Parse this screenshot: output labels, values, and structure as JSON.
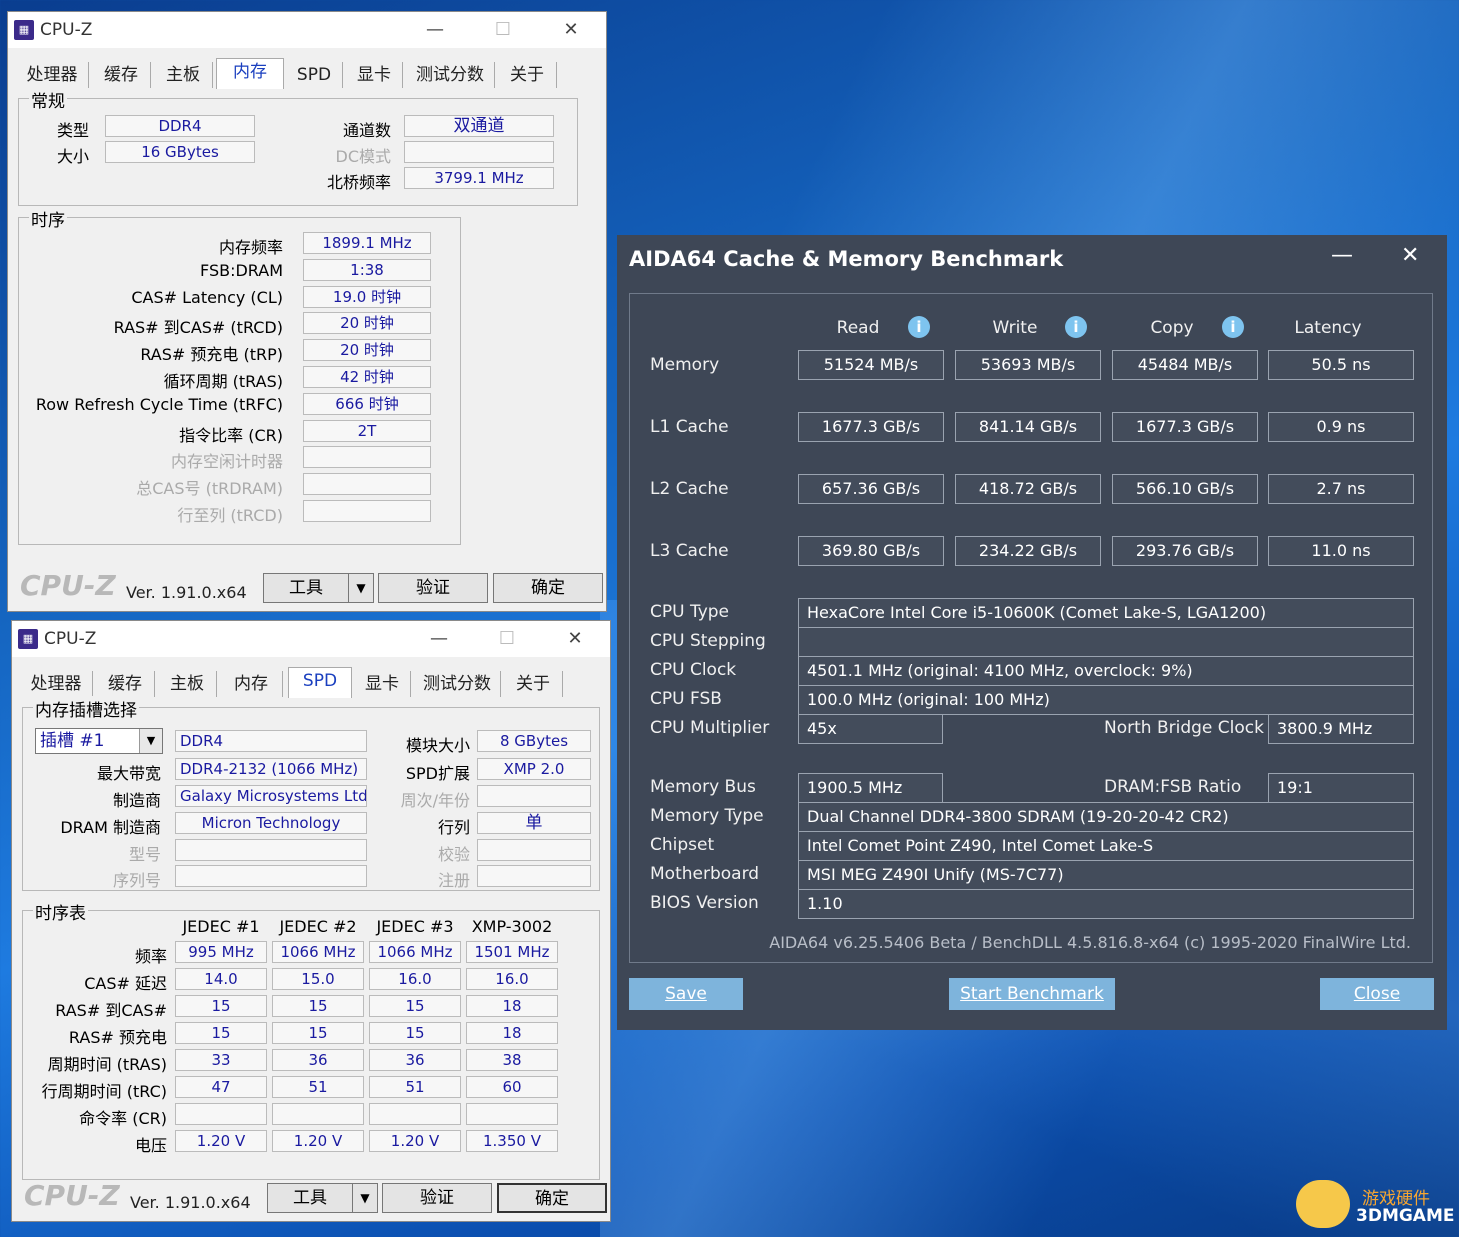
{
  "cpuz_top": {
    "title": "CPU-Z",
    "tabs": [
      "处理器",
      "缓存",
      "主板",
      "内存",
      "SPD",
      "显卡",
      "测试分数",
      "关于"
    ],
    "active_tab": "内存",
    "general": {
      "title": "常规",
      "type_label": "类型",
      "type_value": "DDR4",
      "size_label": "大小",
      "size_value": "16 GBytes",
      "channels_label": "通道数",
      "channels_value": "双通道",
      "dc_label": "DC模式",
      "dc_value": "",
      "nb_label": "北桥频率",
      "nb_value": "3799.1 MHz"
    },
    "timings": {
      "title": "时序",
      "rows": [
        {
          "label": "内存频率",
          "value": "1899.1 MHz",
          "dim": false
        },
        {
          "label": "FSB:DRAM",
          "value": "1:38",
          "dim": false
        },
        {
          "label": "CAS# Latency (CL)",
          "value": "19.0 时钟",
          "dim": false
        },
        {
          "label": "RAS# 到CAS# (tRCD)",
          "value": "20 时钟",
          "dim": false
        },
        {
          "label": "RAS# 预充电 (tRP)",
          "value": "20 时钟",
          "dim": false
        },
        {
          "label": "循环周期 (tRAS)",
          "value": "42 时钟",
          "dim": false
        },
        {
          "label": "Row Refresh Cycle Time (tRFC)",
          "value": "666 时钟",
          "dim": false
        },
        {
          "label": "指令比率 (CR)",
          "value": "2T",
          "dim": false
        },
        {
          "label": "内存空闲计时器",
          "value": "",
          "dim": true
        },
        {
          "label": "总CAS号 (tRDRAM)",
          "value": "",
          "dim": true
        },
        {
          "label": "行至列 (tRCD)",
          "value": "",
          "dim": true
        }
      ]
    },
    "logo": "CPU-Z",
    "version": "Ver. 1.91.0.x64",
    "tools_button": "工具",
    "validate_button": "验证",
    "ok_button": "确定"
  },
  "cpuz_bottom": {
    "title": "CPU-Z",
    "tabs": [
      "处理器",
      "缓存",
      "主板",
      "内存",
      "SPD",
      "显卡",
      "测试分数",
      "关于"
    ],
    "active_tab": "SPD",
    "slot": {
      "title": "内存插槽选择",
      "slot_value": "插槽 #1",
      "type_value": "DDR4",
      "module_size_label": "模块大小",
      "module_size_value": "8 GBytes",
      "max_bw_label": "最大带宽",
      "max_bw_value": "DDR4-2132 (1066 MHz)",
      "spd_ext_label": "SPD扩展",
      "spd_ext_value": "XMP 2.0",
      "mfr_label": "制造商",
      "mfr_value": "Galaxy Microsystems Ltd.",
      "week_label": "周次/年份",
      "week_value": "",
      "dram_mfr_label": "DRAM 制造商",
      "dram_mfr_value": "Micron Technology",
      "ranks_label": "行列",
      "ranks_value": "单",
      "model_label": "型号",
      "model_value": "",
      "check_label": "校验",
      "check_value": "",
      "serial_label": "序列号",
      "serial_value": "",
      "reg_label": "注册",
      "reg_value": ""
    },
    "timing_table": {
      "title": "时序表",
      "columns": [
        "JEDEC #1",
        "JEDEC #2",
        "JEDEC #3",
        "XMP-3002"
      ],
      "rows": [
        {
          "label": "频率",
          "values": [
            "995 MHz",
            "1066 MHz",
            "1066 MHz",
            "1501 MHz"
          ]
        },
        {
          "label": "CAS# 延迟",
          "values": [
            "14.0",
            "15.0",
            "16.0",
            "16.0"
          ]
        },
        {
          "label": "RAS# 到CAS#",
          "values": [
            "15",
            "15",
            "15",
            "18"
          ]
        },
        {
          "label": "RAS# 预充电",
          "values": [
            "15",
            "15",
            "15",
            "18"
          ]
        },
        {
          "label": "周期时间 (tRAS)",
          "values": [
            "33",
            "36",
            "36",
            "38"
          ]
        },
        {
          "label": "行周期时间 (tRC)",
          "values": [
            "47",
            "51",
            "51",
            "60"
          ]
        },
        {
          "label": "命令率 (CR)",
          "values": [
            "",
            "",
            "",
            ""
          ]
        },
        {
          "label": "电压",
          "values": [
            "1.20 V",
            "1.20 V",
            "1.20 V",
            "1.350 V"
          ]
        }
      ]
    },
    "logo": "CPU-Z",
    "version": "Ver. 1.91.0.x64",
    "tools_button": "工具",
    "validate_button": "验证",
    "ok_button": "确定"
  },
  "aida": {
    "title": "AIDA64 Cache & Memory Benchmark",
    "headers": [
      "Read",
      "Write",
      "Copy",
      "Latency"
    ],
    "bench_rows": [
      {
        "label": "Memory",
        "values": [
          "51524 MB/s",
          "53693 MB/s",
          "45484 MB/s",
          "50.5 ns"
        ]
      },
      {
        "label": "L1 Cache",
        "values": [
          "1677.3 GB/s",
          "841.14 GB/s",
          "1677.3 GB/s",
          "0.9 ns"
        ]
      },
      {
        "label": "L2 Cache",
        "values": [
          "657.36 GB/s",
          "418.72 GB/s",
          "566.10 GB/s",
          "2.7 ns"
        ]
      },
      {
        "label": "L3 Cache",
        "values": [
          "369.80 GB/s",
          "234.22 GB/s",
          "293.76 GB/s",
          "11.0 ns"
        ]
      }
    ],
    "cpu_type_label": "CPU Type",
    "cpu_type": "HexaCore Intel Core i5-10600K  (Comet Lake-S, LGA1200)",
    "cpu_stepping_label": "CPU Stepping",
    "cpu_stepping": "",
    "cpu_clock_label": "CPU Clock",
    "cpu_clock": "4501.1 MHz  (original: 4100 MHz, overclock: 9%)",
    "cpu_fsb_label": "CPU FSB",
    "cpu_fsb": "100.0 MHz  (original: 100 MHz)",
    "cpu_mult_label": "CPU Multiplier",
    "cpu_mult": "45x",
    "nb_clock_label": "North Bridge Clock",
    "nb_clock": "3800.9 MHz",
    "mem_bus_label": "Memory Bus",
    "mem_bus": "1900.5 MHz",
    "dram_fsb_label": "DRAM:FSB Ratio",
    "dram_fsb": "19:1",
    "mem_type_label": "Memory Type",
    "mem_type": "Dual Channel DDR4-3800 SDRAM  (19-20-20-42 CR2)",
    "chipset_label": "Chipset",
    "chipset": "Intel Comet Point Z490, Intel Comet Lake-S",
    "mobo_label": "Motherboard",
    "mobo": "MSI MEG Z490I Unify (MS-7C77)",
    "bios_label": "BIOS Version",
    "bios": "1.10",
    "footer": "AIDA64 v6.25.5406 Beta / BenchDLL 4.5.816.8-x64  (c) 1995-2020 FinalWire Ltd.",
    "save_button": "Save",
    "start_button": "Start Benchmark",
    "close_button": "Close",
    "minimize_glyph": "—",
    "close_glyph": "✕"
  },
  "watermark": {
    "line1": "游戏硬件",
    "line2": "3DMGAME"
  },
  "window_glyphs": {
    "minimize": "—",
    "maximize": "☐",
    "close": "✕",
    "dropdown": "▼"
  }
}
